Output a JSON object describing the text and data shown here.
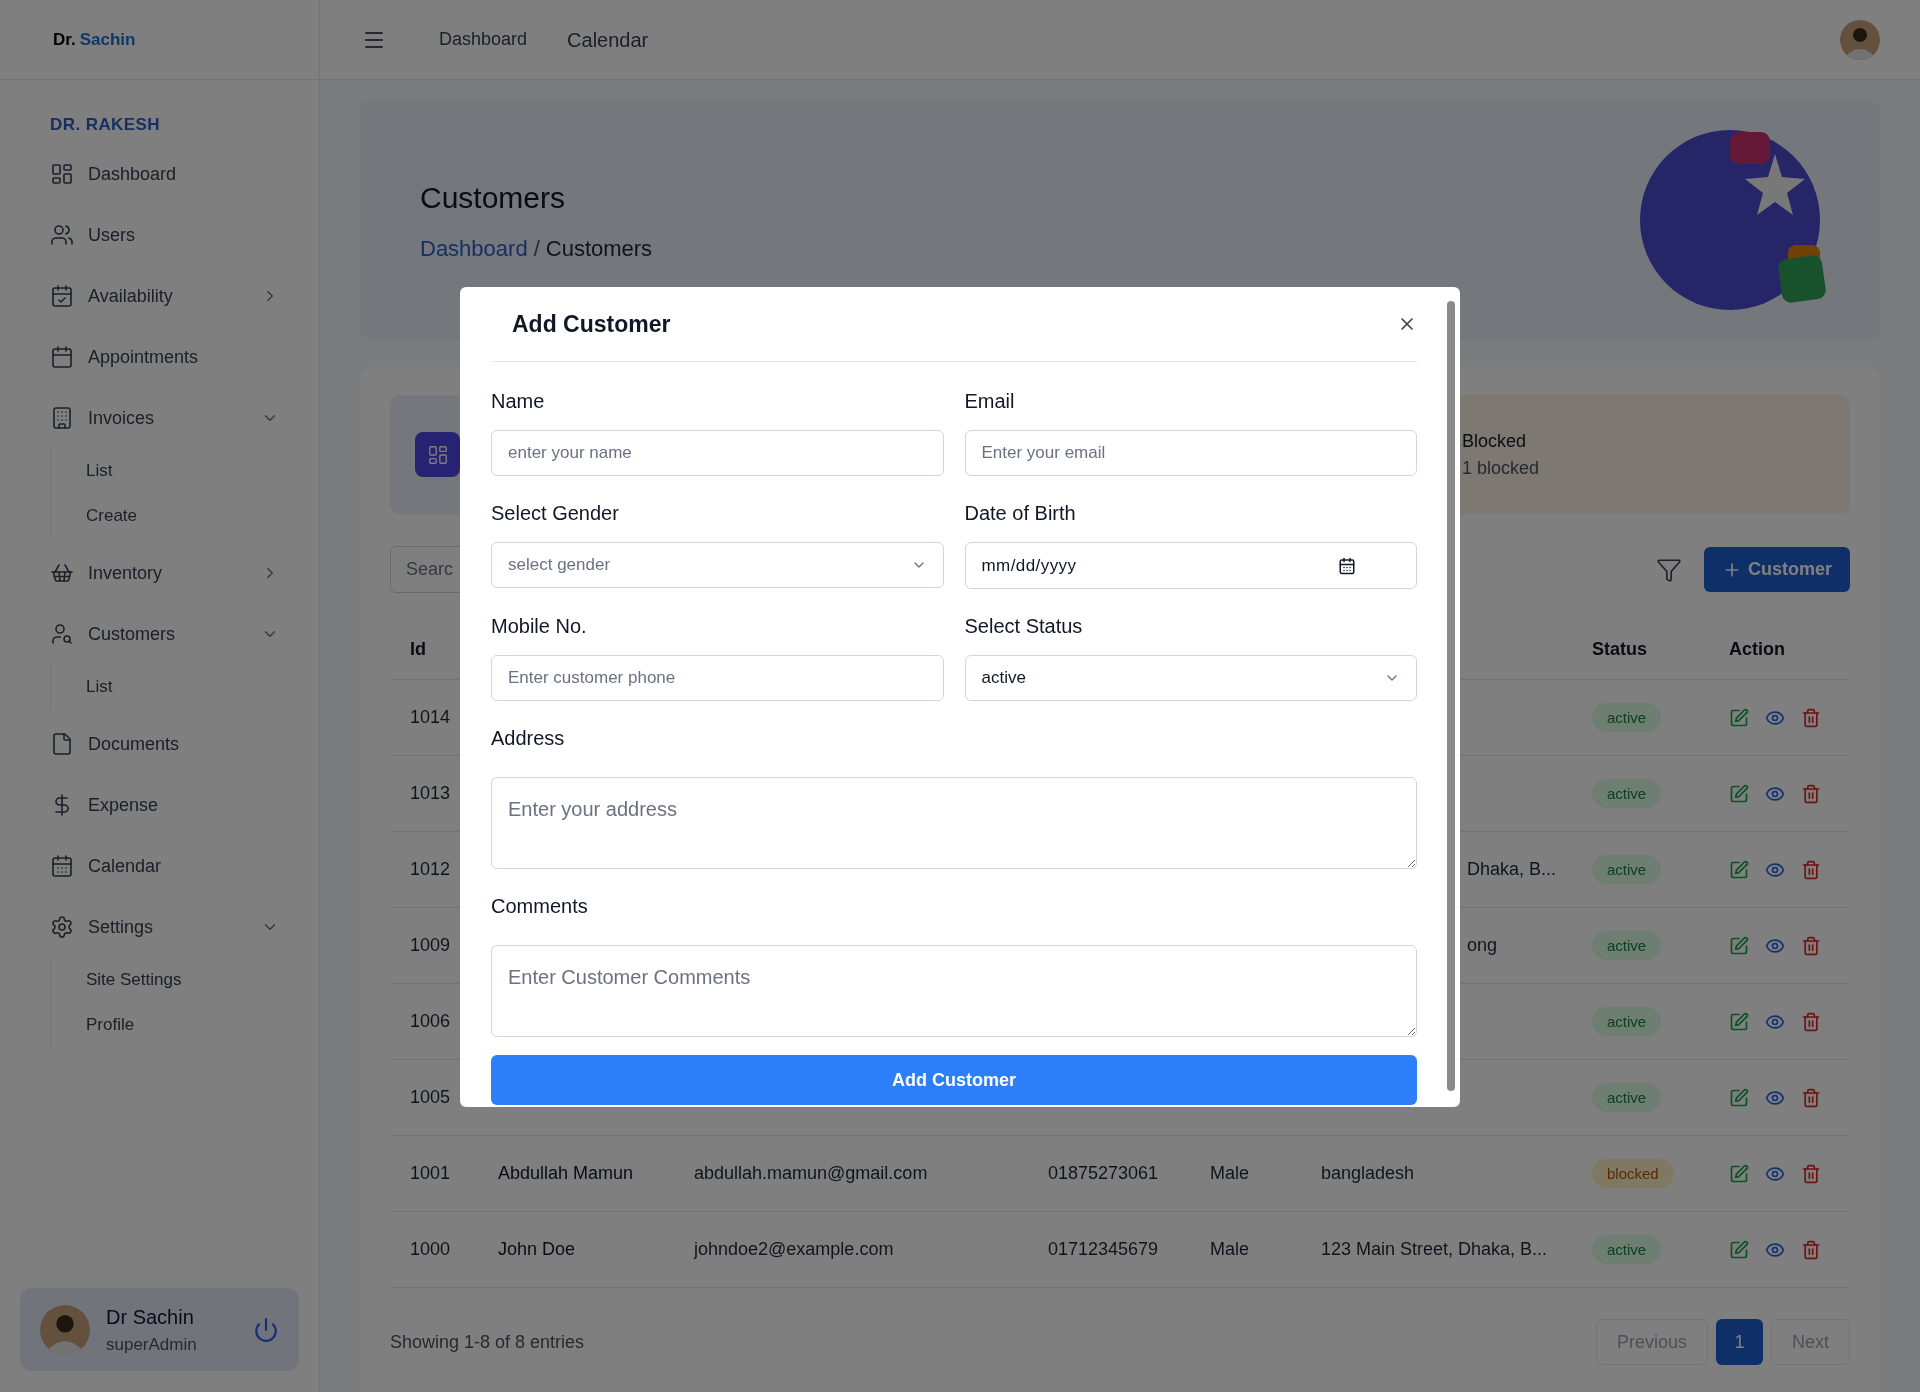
{
  "header": {
    "logo_prefix": "Dr.",
    "logo_name": "Sachin",
    "nav": [
      "Dashboard",
      "Calendar"
    ]
  },
  "sidebar": {
    "heading": "DR. RAKESH",
    "items": [
      {
        "label": "Dashboard"
      },
      {
        "label": "Users"
      },
      {
        "label": "Availability",
        "expanded": false
      },
      {
        "label": "Appointments"
      },
      {
        "label": "Invoices",
        "expanded": true,
        "children": [
          {
            "label": "List"
          },
          {
            "label": "Create"
          }
        ]
      },
      {
        "label": "Inventory",
        "expanded": false
      },
      {
        "label": "Customers",
        "expanded": true,
        "children": [
          {
            "label": "List"
          }
        ]
      },
      {
        "label": "Documents"
      },
      {
        "label": "Expense"
      },
      {
        "label": "Calendar"
      },
      {
        "label": "Settings",
        "expanded": true,
        "children": [
          {
            "label": "Site Settings"
          },
          {
            "label": "Profile"
          }
        ]
      }
    ],
    "user": {
      "name": "Dr Sachin",
      "role": "superAdmin"
    }
  },
  "page": {
    "title": "Customers",
    "breadcrumb": {
      "link": "Dashboard",
      "separator": "/",
      "current": "Customers"
    }
  },
  "stats": {
    "blocked": {
      "title": "Blocked",
      "count": "1 blocked"
    }
  },
  "toolbar": {
    "search_placeholder": "Searc",
    "add_button": "Customer"
  },
  "table": {
    "columns": {
      "id": "Id",
      "status": "Status",
      "action": "Action"
    },
    "rows": [
      {
        "id": "1014",
        "status": "active",
        "kind": "active"
      },
      {
        "id": "1013",
        "status": "active",
        "kind": "active"
      },
      {
        "id": "1012",
        "address": "Dhaka, B...",
        "cut_off": true,
        "status": "active",
        "kind": "active"
      },
      {
        "id": "1009",
        "address": "ong",
        "cut_off": true,
        "status": "active",
        "kind": "active"
      },
      {
        "id": "1006",
        "status": "active",
        "kind": "active"
      },
      {
        "id": "1005",
        "status": "active",
        "kind": "active"
      },
      {
        "id": "1001",
        "name": "Abdullah Mamun",
        "email": "abdullah.mamun@gmail.com",
        "mobile": "01875273061",
        "gender": "Male",
        "address": "bangladesh",
        "status": "blocked",
        "kind": "blocked"
      },
      {
        "id": "1000",
        "name": "John Doe",
        "email": "johndoe2@example.com",
        "mobile": "01712345679",
        "gender": "Male",
        "address": "123 Main Street, Dhaka, B...",
        "status": "active",
        "kind": "active"
      }
    ]
  },
  "footer": {
    "summary": "Showing 1-8 of 8 entries",
    "previous": {
      "label": "Previous",
      "disabled": true
    },
    "pages": [
      {
        "label": "1",
        "selected": true
      }
    ],
    "next": {
      "label": "Next",
      "disabled": true
    }
  },
  "modal": {
    "title": "Add Customer",
    "fields": [
      {
        "label": "Name",
        "kind": "text",
        "placeholder": "enter your name"
      },
      {
        "label": "Email",
        "kind": "text",
        "placeholder": "Enter your email"
      },
      {
        "label": "Select Gender",
        "kind": "select",
        "placeholder": "select gender"
      },
      {
        "label": "Date of Birth",
        "kind": "date",
        "value": "mm/dd/yyyy"
      },
      {
        "label": "Mobile No.",
        "kind": "text",
        "placeholder": "Enter customer phone"
      },
      {
        "label": "Select Status",
        "kind": "select",
        "value": "active"
      },
      {
        "label": "Address",
        "kind": "textarea",
        "placeholder": "Enter your address"
      },
      {
        "label": "Comments",
        "kind": "textarea",
        "placeholder": "Enter Customer Comments"
      }
    ],
    "submit": "Add Customer"
  }
}
